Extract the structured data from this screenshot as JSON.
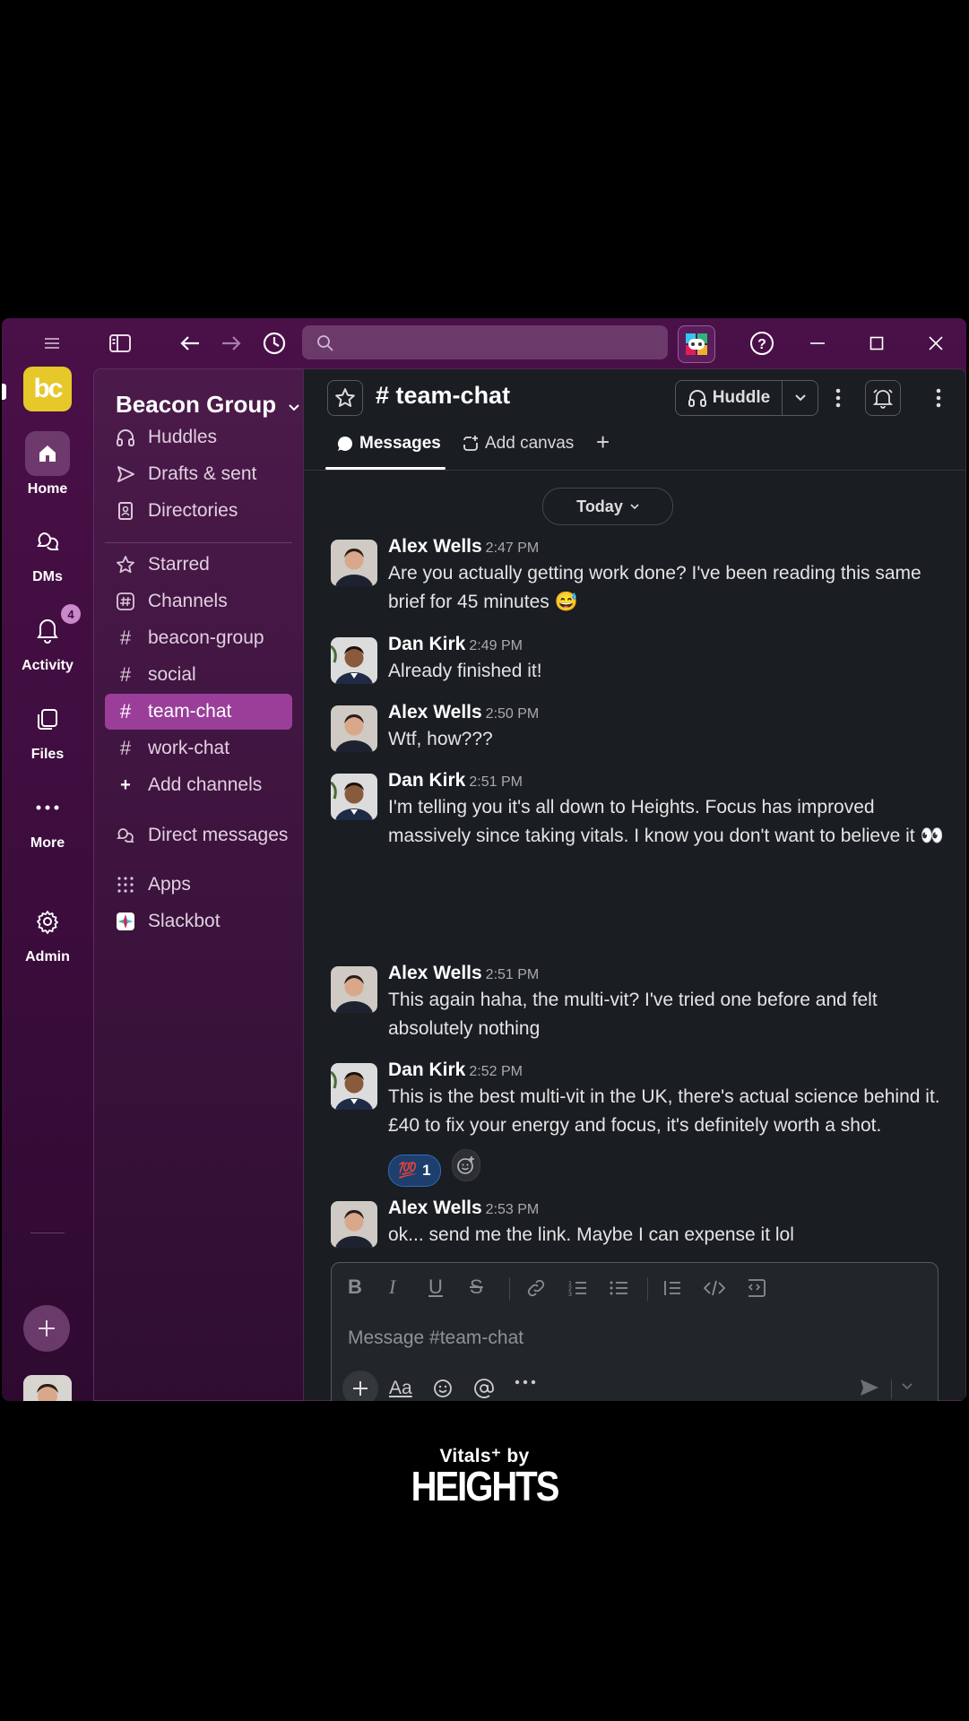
{
  "search": {
    "placeholder": ""
  },
  "rail": {
    "workspace_logo": "bc",
    "items": [
      {
        "label": "Home",
        "icon": "home-icon"
      },
      {
        "label": "DMs",
        "icon": "dm-icon"
      },
      {
        "label": "Activity",
        "icon": "bell-icon",
        "badge": "4"
      },
      {
        "label": "Files",
        "icon": "files-icon"
      },
      {
        "label": "More",
        "icon": "more-icon"
      },
      {
        "label": "Admin",
        "icon": "gear-icon"
      }
    ]
  },
  "sidebar": {
    "workspace_name": "Beacon Group",
    "top_items": [
      "Huddles",
      "Drafts & sent",
      "Directories"
    ],
    "starred": "Starred",
    "channels_header": "Channels",
    "channels": [
      "beacon-group",
      "social",
      "team-chat",
      "work-chat"
    ],
    "active_channel": "team-chat",
    "add_channels": "Add channels",
    "direct_messages": "Direct messages",
    "apps": "Apps",
    "slackbot": "Slackbot"
  },
  "channel": {
    "name": "team-chat",
    "huddle_label": "Huddle",
    "tabs": {
      "messages": "Messages",
      "add_canvas": "Add canvas"
    },
    "date_divider": "Today"
  },
  "messages": [
    {
      "author": "Alex Wells",
      "time": "2:47 PM",
      "text": "Are you actually getting work done? I've been reading this same brief for 45 minutes 😅"
    },
    {
      "author": "Dan Kirk",
      "time": "2:49 PM",
      "text": "Already finished it!"
    },
    {
      "author": "Alex Wells",
      "time": "2:50 PM",
      "text": "Wtf, how???"
    },
    {
      "author": "Dan Kirk",
      "time": "2:51 PM",
      "text": "I'm telling you it's all down to Heights. Focus has improved massively since taking vitals. I know you don't want to believe it 👀"
    },
    {
      "author": "Alex Wells",
      "time": "2:51 PM",
      "text": "This again haha, the multi-vit? I've tried one before and felt absolutely nothing"
    },
    {
      "author": "Dan Kirk",
      "time": "2:52 PM",
      "text": "This is the best multi-vit in the UK, there's actual science behind it. £40 to fix your energy and focus, it's definitely worth a shot.",
      "reaction": {
        "emoji": "💯",
        "count": "1"
      }
    },
    {
      "author": "Alex Wells",
      "time": "2:53 PM",
      "text": "ok... send me the link. Maybe I can expense it lol"
    }
  ],
  "composer": {
    "placeholder": "Message #team-chat",
    "aa_label": "Aa"
  },
  "branding": {
    "line1": "Vitals⁺ by",
    "line2": "HEIGHTS"
  },
  "colors": {
    "accent": "#9a3e9a",
    "workspace_logo": "#e6c82a",
    "reaction_bg": "#1d3f6e"
  }
}
